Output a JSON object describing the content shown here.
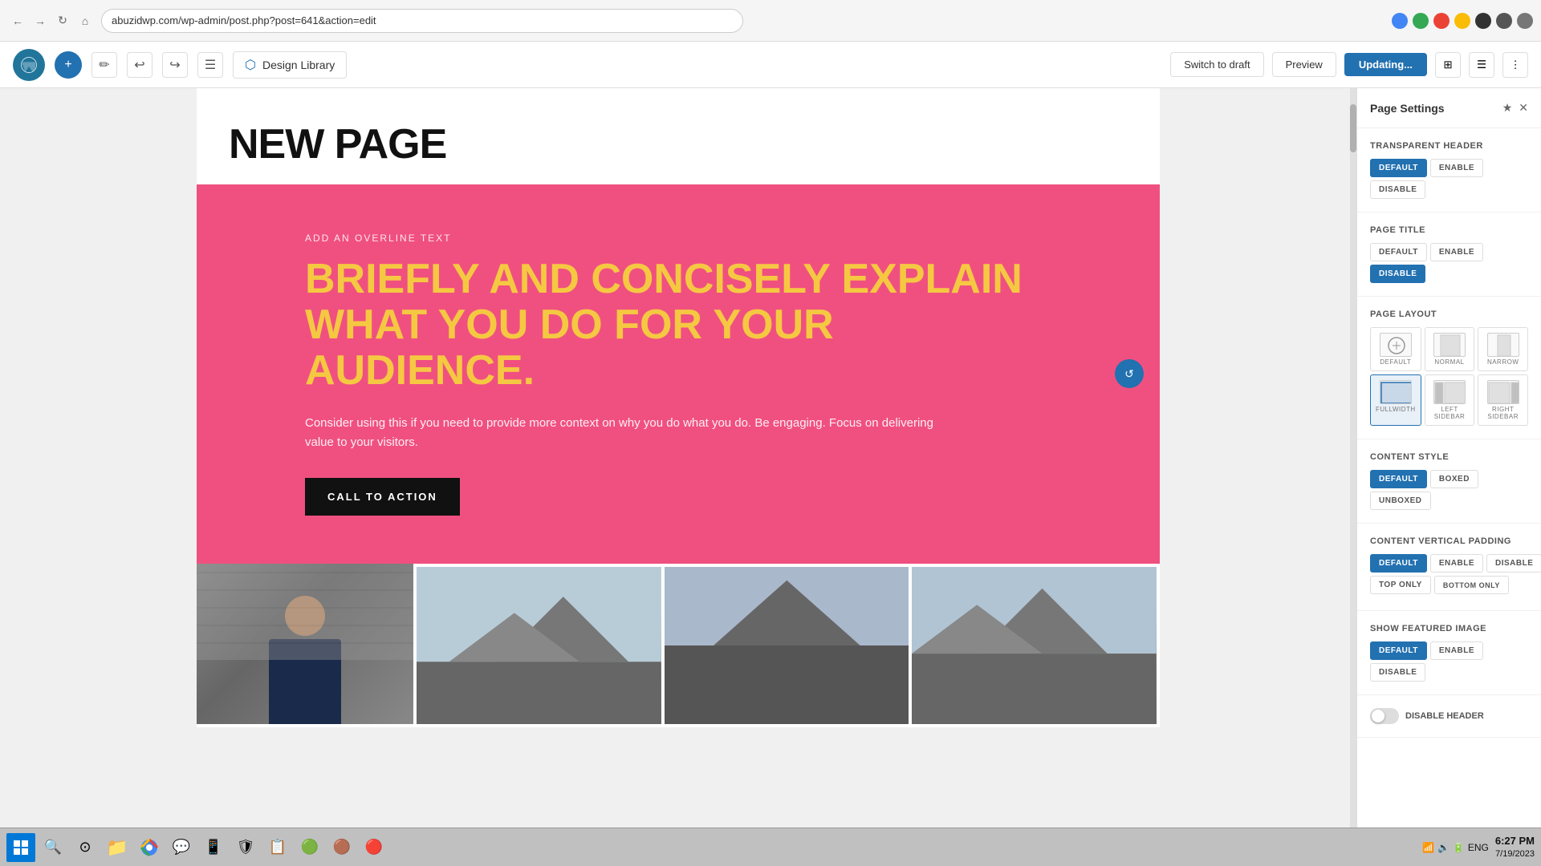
{
  "browser": {
    "url": "abuzidwp.com/wp-admin/post.php?post=641&action=edit",
    "back_btn": "←",
    "forward_btn": "→",
    "reload_btn": "↺",
    "home_btn": "⌂"
  },
  "toolbar": {
    "wp_logo": "W",
    "add_btn": "+",
    "edit_btn": "✏",
    "undo_btn": "↩",
    "redo_btn": "↪",
    "menu_btn": "☰",
    "design_library_label": "Design Library",
    "switch_draft_label": "Switch to draft",
    "preview_label": "Preview",
    "updating_label": "Updating...",
    "view_label": "⊞",
    "settings_label": "⚙",
    "more_label": "⋮"
  },
  "page": {
    "title": "NEW PAGE",
    "hero": {
      "overline": "ADD AN OVERLINE TEXT",
      "headline_line1": "BRIEFLY AND CONCISELY EXPLAIN",
      "headline_line2": "WHAT YOU DO FOR YOUR AUDIENCE.",
      "subtext": "Consider using this if you need to provide more context on why you do what you do. Be engaging. Focus on delivering value to your visitors.",
      "cta": "CALL TO ACTION",
      "bg_color": "#f0527a"
    }
  },
  "settings_panel": {
    "title": "Page Settings",
    "transparent_header": {
      "label": "Transparent Header",
      "options": [
        "DEFAULT",
        "ENABLE",
        "DISABLE"
      ],
      "active": "DEFAULT"
    },
    "page_title": {
      "label": "Page Title",
      "options": [
        "DEFAULT",
        "ENABLE",
        "DISABLE"
      ],
      "active": "DISABLE"
    },
    "page_layout": {
      "label": "Page Layout",
      "options": [
        {
          "id": "default",
          "label": "DEFAULT",
          "active": false
        },
        {
          "id": "normal",
          "label": "NORMAL",
          "active": false
        },
        {
          "id": "narrow",
          "label": "NARROW",
          "active": false
        },
        {
          "id": "fullwidth",
          "label": "FULLWIDTH",
          "active": true
        },
        {
          "id": "left-sidebar",
          "label": "LEFT SIDEBAR",
          "active": false
        },
        {
          "id": "right-sidebar",
          "label": "RIGHT SIDEBAR",
          "active": false
        }
      ]
    },
    "content_style": {
      "label": "Content Style",
      "options": [
        "DEFAULT",
        "BOXED",
        "UNBOXED"
      ],
      "active": "DEFAULT"
    },
    "content_vertical_padding": {
      "label": "Content Vertical Padding",
      "row1": [
        "DEFAULT",
        "ENABLE",
        "DISABLE"
      ],
      "row2": [
        "TOP ONLY",
        "BOTTOM ONLY"
      ],
      "active": "DEFAULT"
    },
    "show_featured_image": {
      "label": "Show Featured Image",
      "options": [
        "DEFAULT",
        "ENABLE",
        "DISABLE"
      ],
      "active": "DEFAULT"
    },
    "disable_header_label": "Disable Header"
  },
  "taskbar": {
    "time": "6:27 PM",
    "date": "7/19/2023",
    "language": "ENG"
  }
}
